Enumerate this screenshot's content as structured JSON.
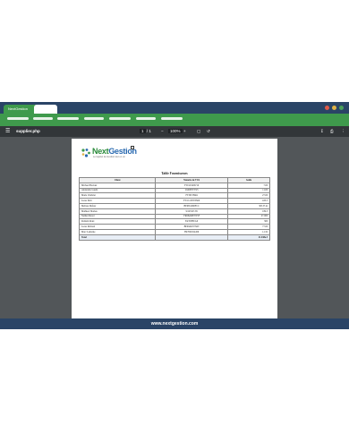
{
  "browser": {
    "tab_label": "NextGestion",
    "window_dot_colors": [
      "#e05a47",
      "#e0b347",
      "#4aa05a"
    ]
  },
  "pdf": {
    "filename": "supplier.php",
    "menu_icon": "hamburger-icon",
    "page_current": "1",
    "page_sep": "/",
    "page_total": "1",
    "zoom": "100%",
    "zoom_out": "−",
    "zoom_in": "+",
    "download_icon": "download-icon",
    "print_icon": "print-icon",
    "more_icon": "more-icon"
  },
  "document": {
    "logo_text_a": "Next",
    "logo_text_b": "Gestion",
    "logo_tag": "Le logiciel de Gestion tout en un",
    "title": "Table Fournisseurs",
    "columns": [
      "Client",
      "Numéro de TVA",
      "Solde"
    ],
    "rows": [
      [
        "Michael Bouvier",
        "FT0123456710",
        "7.00"
      ],
      [
        "Alexandre Gaudé",
        "LM23ET3725",
        "11.00"
      ],
      [
        "Marie Chabrier",
        "FT3672HA9",
        "27.00"
      ],
      [
        "Lucas Petit",
        "FT/CC2979TSDI",
        "1.83.5"
      ],
      [
        "Melissa Dufour",
        "BE0651990FCC",
        "305.55 m"
      ],
      [
        "Mathieu Thomas",
        "9 045327-85",
        "189.3"
      ],
      [
        "Nathan Morel",
        "FR08e66870T5F",
        "27.000"
      ],
      [
        "Romain Roux",
        "FA35TBUG0",
        "300"
      ],
      [
        "Lucas Richard",
        "BE09432573OT",
        "77.00"
      ],
      [
        "Marc Lemoine",
        "FR7826314459",
        "1.1.32"
      ]
    ],
    "total_label": "Total",
    "total_value": "21.048e.5"
  },
  "footer": {
    "text": "www.nextgestion.com"
  }
}
